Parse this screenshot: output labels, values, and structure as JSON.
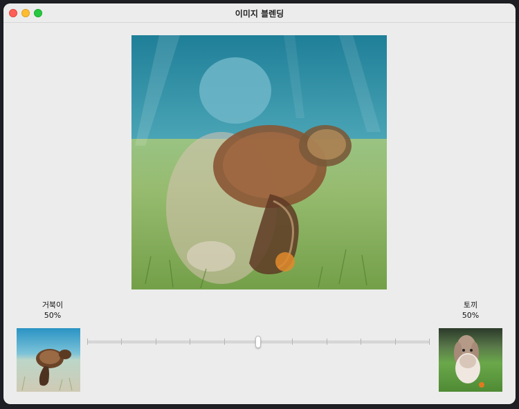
{
  "window": {
    "title": "이미지 블렌딩"
  },
  "left_image": {
    "name": "거북이",
    "percent": "50%"
  },
  "right_image": {
    "name": "토끼",
    "percent": "50%"
  },
  "blend_slider": {
    "min": 0,
    "max": 100,
    "value": 50,
    "tick_count": 11
  },
  "colors": {
    "window_bg": "#ececec",
    "water": "#2f8fa8",
    "grass": "#6fa84a",
    "turtle_shell": "#7a4a2c",
    "rabbit_fur": "#cbb6a6"
  }
}
